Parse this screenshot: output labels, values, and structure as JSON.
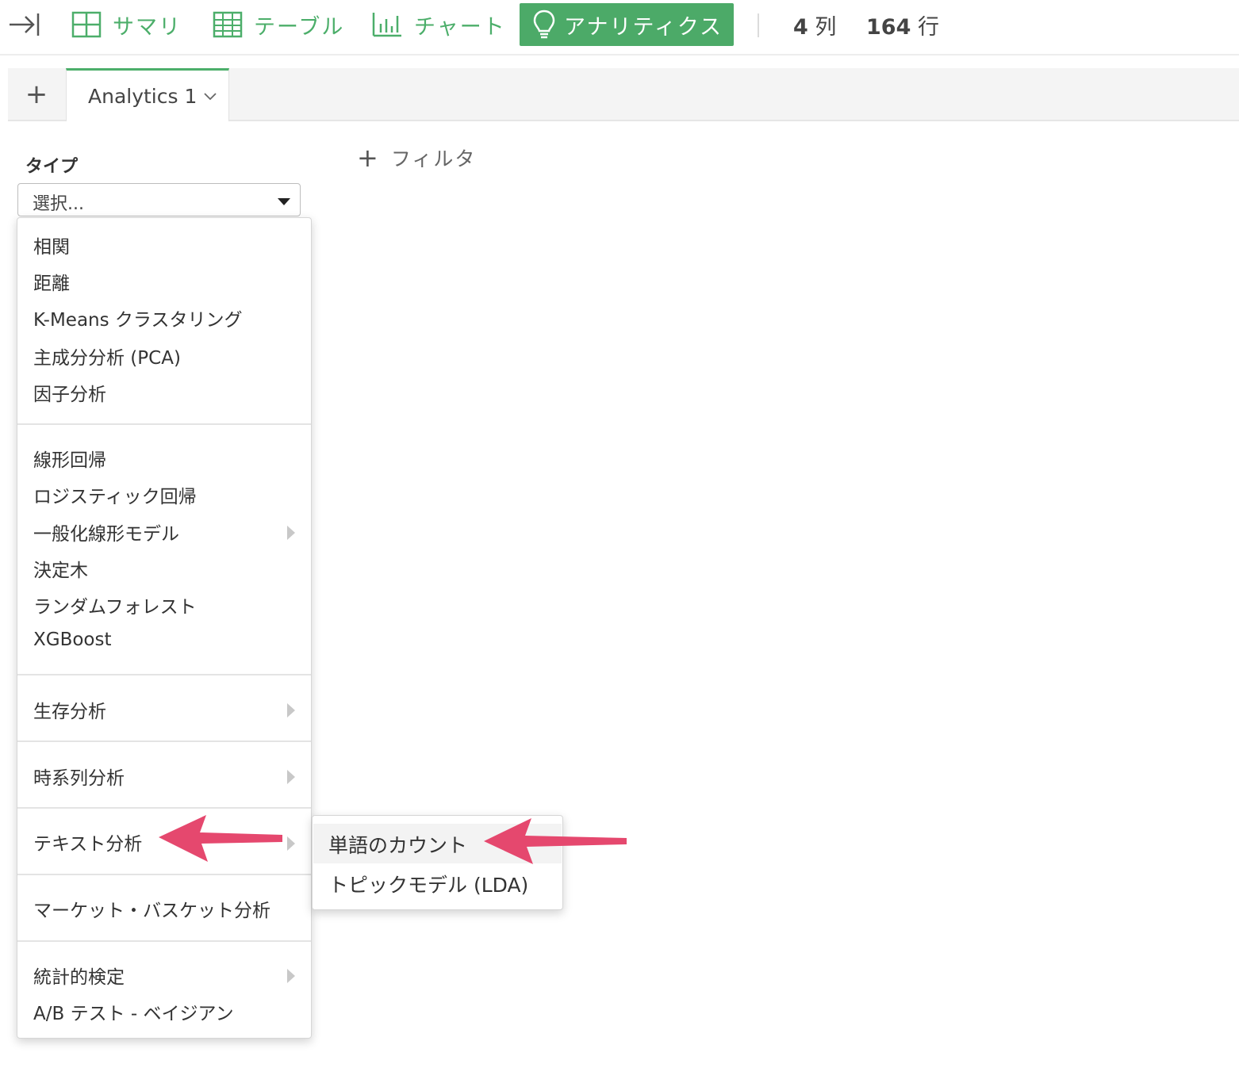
{
  "toolbar": {
    "summary_label": "サマリ",
    "table_label": "テーブル",
    "chart_label": "チャート",
    "analytics_label": "アナリティクス",
    "columns_count": "4",
    "columns_unit": "列",
    "rows_count": "164",
    "rows_unit": "行",
    "accent_color": "#4caa68"
  },
  "tabs": {
    "add_label": "+",
    "active_label": "Analytics 1"
  },
  "type_field": {
    "label": "タイプ",
    "value": "選択..."
  },
  "filter": {
    "add_label": "フィルタ"
  },
  "menu": {
    "groups": [
      [
        "相関",
        "距離",
        "K-Means クラスタリング",
        "主成分分析 (PCA)",
        "因子分析"
      ],
      [
        "線形回帰",
        "ロジスティック回帰",
        "一般化線形モデル",
        "決定木",
        "ランダムフォレスト",
        "XGBoost"
      ],
      [
        "生存分析"
      ],
      [
        "時系列分析"
      ],
      [
        "テキスト分析"
      ],
      [
        "マーケット・バスケット分析"
      ],
      [
        "統計的検定",
        "A/B テスト - ベイジアン"
      ]
    ],
    "submenu_items": [
      "単語のカウント",
      "トピックモデル (LDA)"
    ],
    "annotation_color": "#e5486e"
  }
}
